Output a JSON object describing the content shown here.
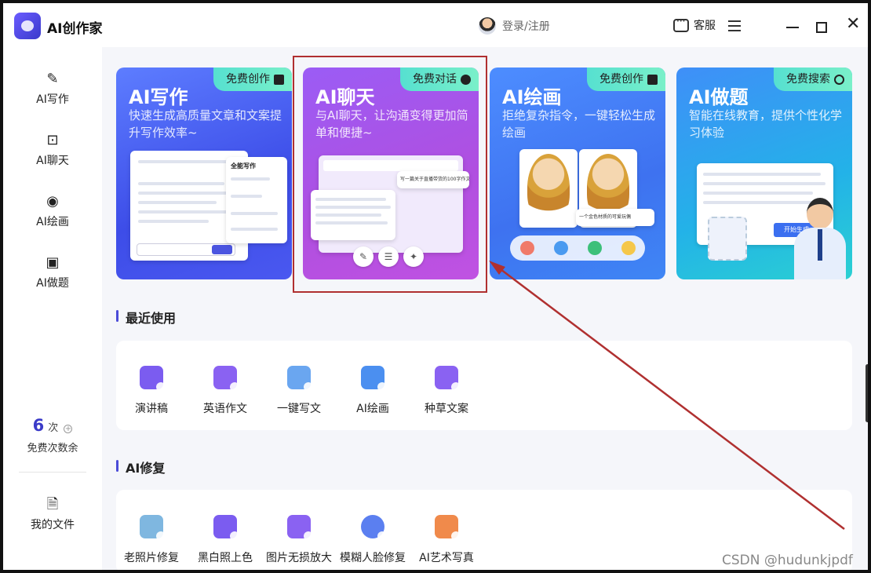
{
  "app": {
    "title": "AI创作家",
    "login_text": "登录/注册",
    "service_text": "客服"
  },
  "sidebar": {
    "items": [
      {
        "label": "AI写作",
        "icon": "pen-icon"
      },
      {
        "label": "AI聊天",
        "icon": "chat-icon"
      },
      {
        "label": "AI绘画",
        "icon": "palette-icon"
      },
      {
        "label": "AI做题",
        "icon": "bookmark-icon"
      }
    ],
    "free_count": "6",
    "free_count_unit": "次",
    "free_count_label": "免费次数余",
    "my_files": "我的文件"
  },
  "cards": [
    {
      "title": "AI写作",
      "desc": "快速生成高质量文章和文案提升写作效率~",
      "badge": "免费创作"
    },
    {
      "title": "AI聊天",
      "desc": "与AI聊天，让沟通变得更加简单和便捷~",
      "badge": "免费对话"
    },
    {
      "title": "AI绘画",
      "desc": "拒绝复杂指令，一键轻松生成绘画",
      "badge": "免费创作"
    },
    {
      "title": "AI做题",
      "desc": "智能在线教育，提供个性化学习体验",
      "badge": "免费搜索"
    }
  ],
  "card_mock": {
    "write_panel_title": "全能写作",
    "chat_prompt": "写一篇关于直播带货的100字作文",
    "paint_caption": "一个金色材质的可爱玩偶",
    "exam_button": "开始生成"
  },
  "recent": {
    "title": "最近使用",
    "tools": [
      {
        "label": "演讲稿",
        "color": "#7b5cf0"
      },
      {
        "label": "英语作文",
        "color": "#8a62f2"
      },
      {
        "label": "一键写文",
        "color": "#6aa6f0"
      },
      {
        "label": "AI绘画",
        "color": "#4b8ff0"
      },
      {
        "label": "种草文案",
        "color": "#8a62f2"
      }
    ]
  },
  "repair": {
    "title": "AI修复",
    "tools": [
      {
        "label": "老照片修复",
        "color": "#7fb7e0"
      },
      {
        "label": "黑白照上色",
        "color": "#7b5cf0"
      },
      {
        "label": "图片无损放大",
        "color": "#8a62f2"
      },
      {
        "label": "模糊人脸修复",
        "color": "#5b7ff0"
      },
      {
        "label": "AI艺术写真",
        "color": "#f08a4b"
      }
    ]
  },
  "watermark": "CSDN @hudunkjpdf",
  "colors": {
    "accent": "#3b3bc8",
    "highlight_box": "#b03030"
  }
}
